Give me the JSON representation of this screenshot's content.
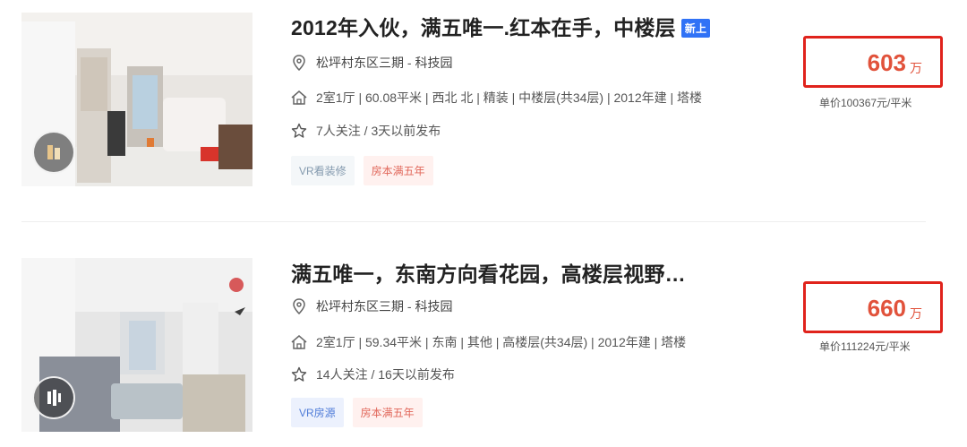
{
  "listings": [
    {
      "title": "2012年入伙，满五唯一.红本在手，中楼层",
      "new_tag": "新上",
      "location": {
        "community": "松坪村东区三期",
        "separator": " - ",
        "area": "科技园"
      },
      "info": "2室1厅 | 60.08平米 | 西北 北 | 精装 | 中楼层(共34层) | 2012年建 | 塔楼",
      "follow": "7人关注 / 3天以前发布",
      "tags": [
        "VR看装修",
        "房本满五年"
      ],
      "total_price": "603",
      "price_unit": "万",
      "unit_price": "单价100367元/平米"
    },
    {
      "title": "满五唯一，东南方向看花园，高楼层视野…",
      "location": {
        "community": "松坪村东区三期",
        "separator": " - ",
        "area": "科技园"
      },
      "info": "2室1厅 | 59.34平米 | 东南 | 其他 | 高楼层(共34层) | 2012年建 | 塔楼",
      "follow": "14人关注 / 16天以前发布",
      "tags": [
        "VR房源",
        "房本满五年"
      ],
      "total_price": "660",
      "price_unit": "万",
      "unit_price": "单价111224元/平米"
    }
  ],
  "icons": [
    "location-pin-icon",
    "house-icon",
    "star-icon",
    "vr-icon"
  ],
  "colors": {
    "price": "#e1523b",
    "highlight_box": "#e0231c",
    "new_tag": "#3072f6"
  }
}
